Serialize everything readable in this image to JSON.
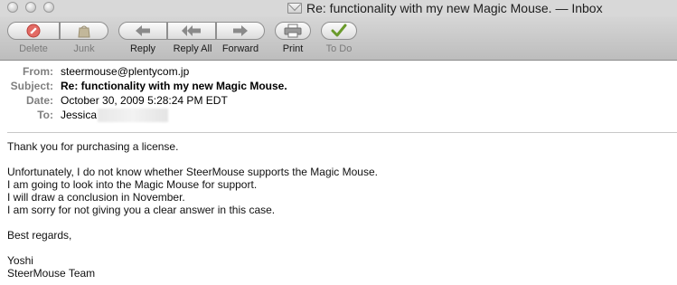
{
  "window": {
    "title": "Re: functionality with my new Magic Mouse. — Inbox",
    "title_icon": "envelope-icon"
  },
  "toolbar": {
    "buttons": [
      {
        "label": "Delete",
        "icon": "delete-icon",
        "enabled": false
      },
      {
        "label": "Junk",
        "icon": "junk-bag-icon",
        "enabled": false
      },
      {
        "label": "Reply",
        "icon": "reply-arrow-icon",
        "enabled": true
      },
      {
        "label": "Reply All",
        "icon": "reply-all-arrow-icon",
        "enabled": true
      },
      {
        "label": "Forward",
        "icon": "forward-arrow-icon",
        "enabled": true
      },
      {
        "label": "Print",
        "icon": "printer-icon",
        "enabled": true
      },
      {
        "label": "To Do",
        "icon": "checkmark-icon",
        "enabled": false
      }
    ]
  },
  "headers": {
    "from_key": "From:",
    "from": "steermouse@plentycom.jp",
    "subject_key": "Subject:",
    "subject": "Re: functionality with my new Magic Mouse.",
    "date_key": "Date:",
    "date": "October 30, 2009 5:28:24 PM EDT",
    "to_key": "To:",
    "to": "Jessica"
  },
  "message": {
    "lines": [
      "Thank you for purchasing a license.",
      "Unfortunately, I do not know whether SteerMouse supports the Magic Mouse.",
      "I am going to look into the Magic Mouse for support.",
      "I will draw a conclusion in November.",
      "I am sorry for not giving you a clear answer in this case.",
      "Best regards,",
      "Yoshi",
      "SteerMouse Team"
    ]
  },
  "colors": {
    "toolbar_bg": "#c9c9c9",
    "header_key": "#7f7f7f",
    "delete_red": "#d9534f",
    "todo_green": "#6a9a2b"
  }
}
